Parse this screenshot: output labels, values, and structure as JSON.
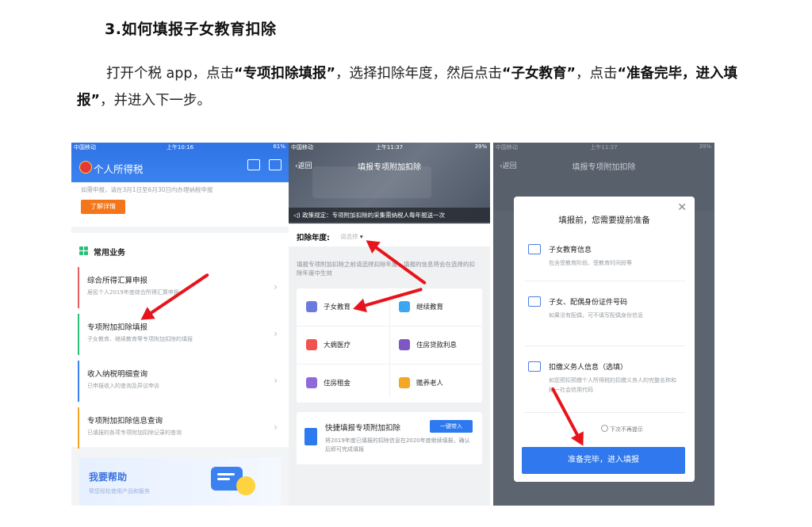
{
  "doc": {
    "heading": "3.如何填报子女教育扣除",
    "para": {
      "indent_text": "打开个税 app，点击",
      "q1": "“专项扣除填报”",
      "mid1": "，选择扣除年度，然后点击",
      "q2": "“子女教育”",
      "mid2": "，点击",
      "q3": "“准备完毕，进入填报”",
      "end": "，并进入下一步。"
    }
  },
  "shot1": {
    "status": {
      "carrier": "中国移动",
      "time": "上午10:16",
      "battery": "61%"
    },
    "app_title": "个人所得税",
    "notice": "如需申报，请在3月1日至6月30日内办理纳税申报",
    "more_btn": "了解详情",
    "section": "常用业务",
    "items": [
      {
        "title": "综合所得汇算申报",
        "sub": "居民个人2019年度综合所得汇算申报",
        "color": "#e85d5d"
      },
      {
        "title": "专项附加扣除填报",
        "sub": "子女教育、继续教育等专项附加扣除的填报",
        "color": "#2bbf7a"
      },
      {
        "title": "收入纳税明细查询",
        "sub": "已申报收入的查询及异议申诉",
        "color": "#3b82f0"
      },
      {
        "title": "专项附加扣除信息查询",
        "sub": "已填报的各项专项附加扣除记录的查询",
        "color": "#f5a623"
      }
    ],
    "help_title": "我要帮助",
    "help_sub": "帮您轻松使用产品和服务"
  },
  "shot2": {
    "status": {
      "carrier": "中国移动",
      "time": "上午11:37",
      "battery": "39%"
    },
    "back": "返回",
    "title": "填报专项附加扣除",
    "policy": "政策规定：专项附加扣除的采集需纳税人每年报送一次",
    "year_label": "扣除年度:",
    "year_placeholder": "请选择",
    "hint": "填报专项附加扣除之前请选择扣除年度，填报的信息将会在选择的扣除年度中生效",
    "cells": [
      {
        "label": "子女教育",
        "color": "#6c7ae0"
      },
      {
        "label": "继续教育",
        "color": "#3ba6f2"
      },
      {
        "label": "大病医疗",
        "color": "#ef5350"
      },
      {
        "label": "住房贷款利息",
        "color": "#7e57c2"
      },
      {
        "label": "住房租金",
        "color": "#8e6bd8"
      },
      {
        "label": "赡养老人",
        "color": "#f5a623"
      }
    ],
    "quick_title": "快捷填报专项附加扣除",
    "quick_btn": "一键带入",
    "quick_desc": "将2019年度已填报的扣除信息在2020年度继续填报，确认后即可完成填报"
  },
  "shot3": {
    "status": {
      "carrier": "中国移动",
      "time": "上午11:37",
      "battery": "39%"
    },
    "back": "返回",
    "title": "填报专项附加扣除",
    "modal_title": "填报前，您需要提前准备",
    "items": [
      {
        "title": "子女教育信息",
        "sub": "包含受教育阶段、受教育时间段等"
      },
      {
        "title": "子女、配偶身份证件号码",
        "sub": "如果没有配偶，可不填写配偶身份信息"
      },
      {
        "title": "扣缴义务人信息（选填）",
        "sub": "如您预扣预缴个人所得税的扣缴义务人的完整名称和统一社会信用代码"
      }
    ],
    "check": "下次不再提示",
    "btn": "准备完毕，进入填报"
  }
}
